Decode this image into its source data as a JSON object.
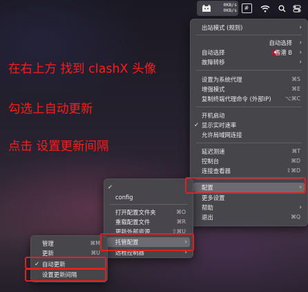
{
  "menubar": {
    "speed_up": "0KB/s",
    "speed_down": "0KB/s",
    "hash_glyph": "#"
  },
  "annotations": {
    "line1": "在右上方 找到 clashX 头像",
    "line2": "勾选上自动更新",
    "line3": "点击 设置更新间隔"
  },
  "main_menu": {
    "items": [
      {
        "label": "出站模式 (规则)",
        "shortcut": "",
        "submenu": true
      },
      {
        "label": "",
        "shortcut": "自动选择",
        "submenu": true
      },
      {
        "label": "自动选择",
        "shortcut": "香港 B",
        "submenu": true
      },
      {
        "label": "故障转移",
        "shortcut": "",
        "submenu": true
      },
      {
        "label": "设置为系统代理",
        "shortcut": "⌘S"
      },
      {
        "label": "增强模式",
        "shortcut": "⌘E"
      },
      {
        "label": "复制终端代理命令 (外部IP)",
        "shortcut": "⌥⌘C"
      },
      {
        "label": "开机启动",
        "shortcut": ""
      },
      {
        "label": "显示实时速率",
        "shortcut": "",
        "checked": true
      },
      {
        "label": "允许局域网连接",
        "shortcut": ""
      },
      {
        "label": "延迟测速",
        "shortcut": "⌘T"
      },
      {
        "label": "控制台",
        "shortcut": "⌘D"
      },
      {
        "label": "连接查看器",
        "shortcut": "⇧⌘D"
      },
      {
        "label": "配置",
        "shortcut": "",
        "submenu": true
      },
      {
        "label": "更多设置",
        "shortcut": ""
      },
      {
        "label": "帮助",
        "shortcut": "",
        "submenu": true
      },
      {
        "label": "退出",
        "shortcut": "⌘Q"
      }
    ]
  },
  "config_menu": {
    "items": [
      {
        "label": "",
        "checked": true
      },
      {
        "label": "config"
      },
      {
        "label": "打开配置文件夹",
        "shortcut": "⌘O"
      },
      {
        "label": "重载配置文件",
        "shortcut": "⌘R"
      },
      {
        "label": "更新外部资源",
        "shortcut": "⇧⌘U"
      },
      {
        "label": "托管配置",
        "submenu": true
      },
      {
        "label": "远程控制器",
        "submenu": true
      }
    ]
  },
  "managed_menu": {
    "items": [
      {
        "label": "管理",
        "shortcut": "⌘M"
      },
      {
        "label": "更新",
        "shortcut": "⌘U"
      },
      {
        "label": "自动更新",
        "checked": true
      },
      {
        "label": "设置更新间隔"
      }
    ]
  },
  "colors": {
    "annotation_red": "#ff1c1c",
    "box_red": "#e41f1f",
    "menu_bg": "#48484c"
  }
}
